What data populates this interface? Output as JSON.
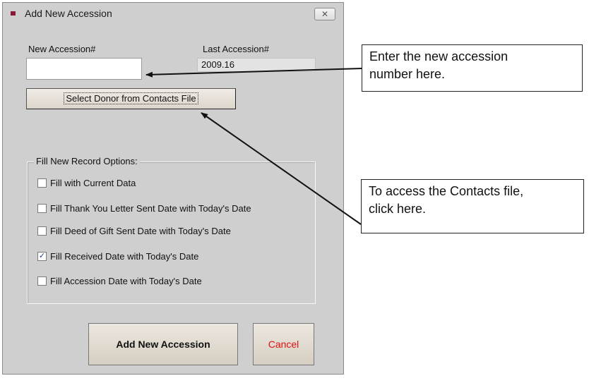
{
  "dialog": {
    "title": "Add New Accession",
    "close_icon": "close-icon"
  },
  "fields": {
    "new_label": "New Accession#",
    "new_value": "",
    "last_label": "Last Accession#",
    "last_value": "2009.16"
  },
  "donor_button": "Select Donor from Contacts File",
  "options": {
    "title": "Fill New Record Options:",
    "items": [
      {
        "label": "Fill with Current Data",
        "checked": false
      },
      {
        "label": "Fill Thank You Letter Sent Date with Today's Date",
        "checked": false
      },
      {
        "label": "Fill Deed of Gift Sent Date with Today's Date",
        "checked": false
      },
      {
        "label": "Fill Received Date with Today's Date",
        "checked": true
      },
      {
        "label": "Fill Accession Date with Today's Date",
        "checked": false
      }
    ]
  },
  "buttons": {
    "add": "Add New Accession",
    "cancel": "Cancel"
  },
  "callouts": {
    "accession_line1": "Enter the new accession",
    "accession_line2": "number here.",
    "contacts_line1": "To access the Contacts file,",
    "contacts_line2": "click here."
  },
  "colors": {
    "dialog_bg": "#cfcfcf",
    "cancel_text": "#e01010",
    "title_icon": "#8b1a3a"
  }
}
